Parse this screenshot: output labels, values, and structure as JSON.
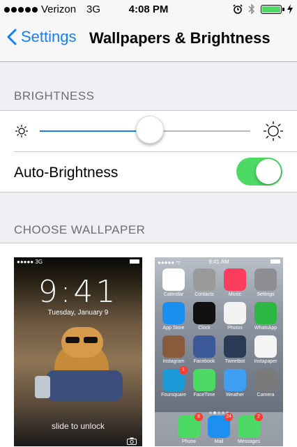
{
  "status_bar": {
    "carrier": "Verizon",
    "network": "3G",
    "time": "4:08 PM"
  },
  "nav": {
    "back_label": "Settings",
    "title": "Wallpapers & Brightness"
  },
  "brightness": {
    "header": "BRIGHTNESS",
    "level": 0.52,
    "auto_label": "Auto-Brightness",
    "auto_on": true
  },
  "wallpaper": {
    "header": "CHOOSE WALLPAPER",
    "lock": {
      "carrier": "3G",
      "time": "9:41",
      "date": "Tuesday, January 9",
      "slide_text": "slide to unlock"
    },
    "home": {
      "time": "9:41 AM",
      "apps": [
        {
          "label": "Calendar",
          "color": "#ffffff",
          "icon": "calendar-icon"
        },
        {
          "label": "Contacts",
          "color": "#9a9a9a",
          "icon": "contacts-icon"
        },
        {
          "label": "Music",
          "color": "#fc3d5e",
          "icon": "music-icon"
        },
        {
          "label": "Settings",
          "color": "#8e8e93",
          "icon": "gear-icon"
        },
        {
          "label": "App Store",
          "color": "#1a8ff0",
          "icon": "app-store-icon"
        },
        {
          "label": "Clock",
          "color": "#111111",
          "icon": "clock-icon"
        },
        {
          "label": "Photos",
          "color": "#f2f2f2",
          "icon": "photos-icon"
        },
        {
          "label": "WhatsApp",
          "color": "#2bb741",
          "icon": "whatsapp-icon"
        },
        {
          "label": "Instagram",
          "color": "#8a5a3c",
          "icon": "instagram-icon"
        },
        {
          "label": "Facebook",
          "color": "#3b5998",
          "icon": "facebook-icon"
        },
        {
          "label": "Tweetbot",
          "color": "#2b3a55",
          "icon": "tweetbot-icon"
        },
        {
          "label": "Instapaper",
          "color": "#f4f4f4",
          "icon": "instapaper-icon"
        },
        {
          "label": "Foursquare",
          "color": "#1a9bd7",
          "icon": "foursquare-icon",
          "badge": "1"
        },
        {
          "label": "FaceTime",
          "color": "#4cd964",
          "icon": "facetime-icon"
        },
        {
          "label": "Weather",
          "color": "#3e9ef2",
          "icon": "weather-icon"
        },
        {
          "label": "Camera",
          "color": "#7a7a7a",
          "icon": "camera-icon"
        }
      ],
      "dock": [
        {
          "label": "Phone",
          "color": "#4cd964",
          "icon": "phone-icon",
          "badge": "8"
        },
        {
          "label": "Mail",
          "color": "#1f8ef2",
          "icon": "mail-icon",
          "badge": "24"
        },
        {
          "label": "Messages",
          "color": "#4cd964",
          "icon": "messages-icon",
          "badge": "2"
        }
      ]
    }
  }
}
